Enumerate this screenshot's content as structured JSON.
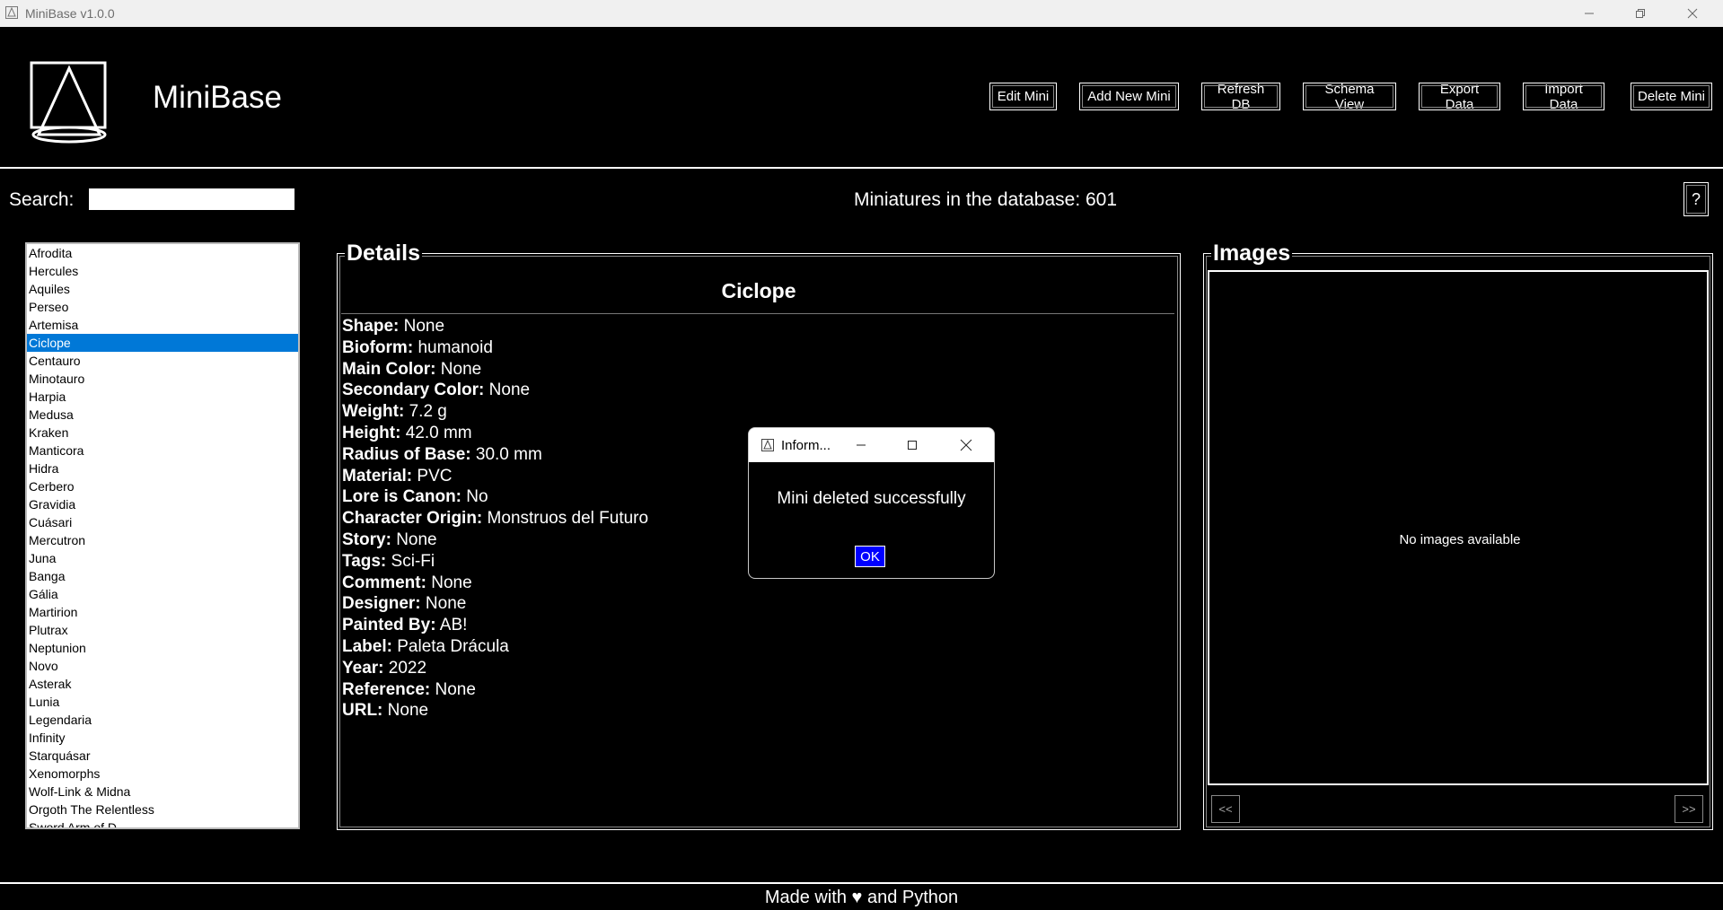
{
  "window": {
    "title": "MiniBase v1.0.0"
  },
  "header": {
    "app_name": "MiniBase"
  },
  "toolbar": {
    "edit": "Edit Mini",
    "add": "Add New Mini",
    "refresh": "Refresh DB",
    "schema": "Schema View",
    "export": "Export Data",
    "import": "Import Data",
    "delete": "Delete Mini"
  },
  "search": {
    "label": "Search:",
    "value": ""
  },
  "count": {
    "label": "Miniatures in the database:",
    "value": "601"
  },
  "help": {
    "label": "?"
  },
  "list": {
    "selected_index": 5,
    "items": [
      "Afrodita",
      "Hercules",
      "Aquiles",
      "Perseo",
      "Artemisa",
      "Ciclope",
      "Centauro",
      "Minotauro",
      "Harpia",
      "Medusa",
      "Kraken",
      "Manticora",
      "Hidra",
      "Cerbero",
      "Gravidia",
      "Cuásari",
      "Mercutron",
      "Juna",
      "Banga",
      "Gália",
      "Martirion",
      "Plutrax",
      "Neptunion",
      "Novo",
      "Asterak",
      "Lunia",
      "Legendaria",
      "Infinity",
      "Starquásar",
      "Xenomorphs",
      "Wolf-Link & Midna",
      "Orgoth The Relentless",
      "Sword Arm of D..."
    ]
  },
  "details": {
    "title": "Details",
    "name": "Ciclope",
    "fields": [
      {
        "label": "Shape:",
        "value": "None"
      },
      {
        "label": "Bioform:",
        "value": "humanoid"
      },
      {
        "label": "Main Color:",
        "value": "None"
      },
      {
        "label": "Secondary Color:",
        "value": "None"
      },
      {
        "label": "Weight:",
        "value": "7.2 g"
      },
      {
        "label": "Height:",
        "value": "42.0 mm"
      },
      {
        "label": "Radius of Base:",
        "value": "30.0 mm"
      },
      {
        "label": "Material:",
        "value": "PVC"
      },
      {
        "label": "Lore is Canon:",
        "value": "No"
      },
      {
        "label": "Character Origin:",
        "value": "Monstruos del Futuro"
      },
      {
        "label": "Story:",
        "value": "None"
      },
      {
        "label": "Tags:",
        "value": "Sci-Fi"
      },
      {
        "label": "Comment:",
        "value": "None"
      },
      {
        "label": "Designer:",
        "value": "None"
      },
      {
        "label": "Painted By:",
        "value": "AB!"
      },
      {
        "label": "Label:",
        "value": "Paleta Drácula"
      },
      {
        "label": "Year:",
        "value": "2022"
      },
      {
        "label": "Reference:",
        "value": "None"
      },
      {
        "label": "URL:",
        "value": "None"
      }
    ]
  },
  "images": {
    "title": "Images",
    "empty_text": "No images available",
    "prev_label": "<<",
    "next_label": ">>"
  },
  "footer": {
    "text": "Made with ♥ and Python"
  },
  "dialog": {
    "title": "Inform...",
    "message": "Mini deleted successfully",
    "ok_label": "OK"
  },
  "colors": {
    "background": "#000000",
    "selection": "#0078d7",
    "ok_button": "#0000ff"
  }
}
